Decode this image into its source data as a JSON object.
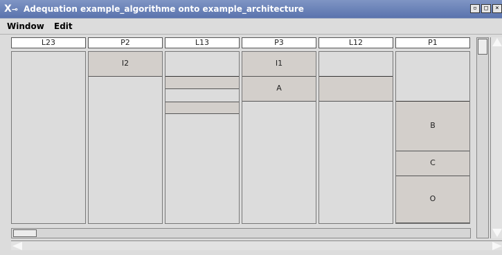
{
  "window": {
    "title": "Adequation example_algorithme onto example_architecture",
    "icon": "x-window-icon",
    "buttons": [
      {
        "name": "minimize-button",
        "glyph": "▫"
      },
      {
        "name": "maximize-button",
        "glyph": "□"
      },
      {
        "name": "close-button",
        "glyph": "×"
      }
    ],
    "titlebar_color": "#6b82b8"
  },
  "menubar": {
    "items": [
      "Window",
      "Edit"
    ]
  },
  "columns": [
    {
      "label": "L23",
      "blocks": []
    },
    {
      "label": "P2",
      "blocks": [
        {
          "label": "I2"
        }
      ]
    },
    {
      "label": "L13",
      "blocks": [
        {
          "label": ""
        },
        {
          "label": ""
        }
      ]
    },
    {
      "label": "P3",
      "blocks": [
        {
          "label": "I1"
        },
        {
          "label": "A"
        }
      ]
    },
    {
      "label": "L12",
      "blocks": [
        {
          "label": ""
        }
      ]
    },
    {
      "label": "P1",
      "blocks": [
        {
          "label": "B"
        },
        {
          "label": "C"
        },
        {
          "label": "O"
        }
      ]
    }
  ],
  "colors": {
    "block_fill": "#d3cfcb",
    "column_fill": "#dcdcdc"
  }
}
